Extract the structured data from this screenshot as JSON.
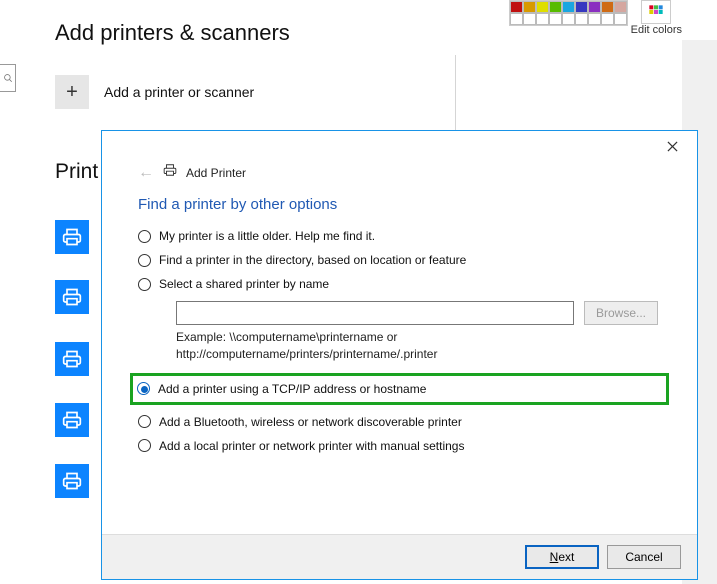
{
  "palette_fragment": {
    "rows": [
      [
        "#c01010",
        "#d89a00",
        "#dede00",
        "#57bb00",
        "#1aa6e0",
        "#3638c0",
        "#8a2fc0",
        "#cf6b15",
        "#d5a7a0"
      ],
      [
        "#ffffff",
        "#ffffff",
        "#ffffff",
        "#ffffff",
        "#ffffff",
        "#ffffff",
        "#ffffff",
        "#ffffff",
        "#ffffff"
      ]
    ],
    "edit_colors_label": "Edit colors"
  },
  "settings": {
    "page_title": "Add printers & scanners",
    "add_label": "Add a printer or scanner",
    "section_heading": "Print"
  },
  "dialog": {
    "title": "Add Printer",
    "heading": "Find a printer by other options",
    "options": {
      "older": "My printer is a little older. Help me find it.",
      "directory": "Find a printer in the directory, based on location or feature",
      "shared": "Select a shared printer by name",
      "tcpip": "Add a printer using a TCP/IP address or hostname",
      "bluetooth": "Add a Bluetooth, wireless or network discoverable printer",
      "local": "Add a local printer or network printer with manual settings"
    },
    "share_input": "",
    "browse_label": "Browse...",
    "example_line1": "Example: \\\\computername\\printername or",
    "example_line2": "http://computername/printers/printername/.printer",
    "next_prefix": "N",
    "next_rest": "ext",
    "cancel": "Cancel"
  }
}
